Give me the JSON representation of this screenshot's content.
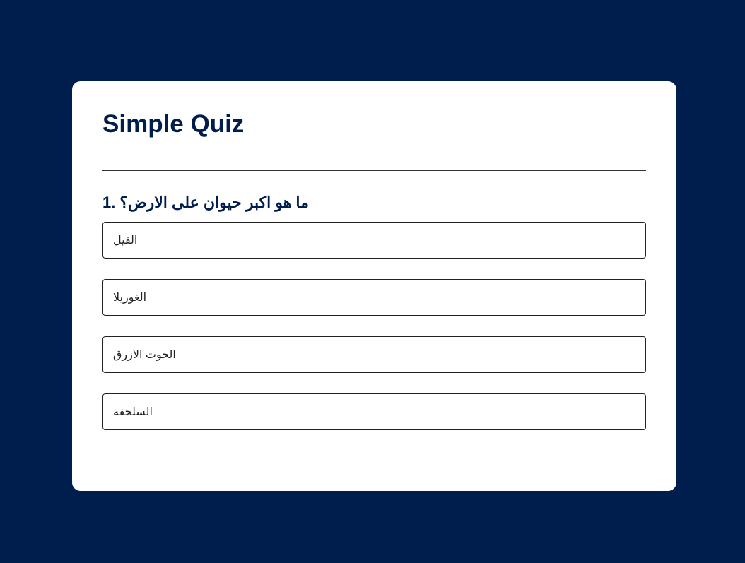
{
  "quiz": {
    "title": "Simple Quiz",
    "question": {
      "number": "1.",
      "text": "ما هو اكبر حيوان على الارض؟"
    },
    "answers": [
      {
        "label": "الفيل"
      },
      {
        "label": "الغوريلا"
      },
      {
        "label": "الحوت الازرق"
      },
      {
        "label": "السلحفة"
      }
    ]
  },
  "colors": {
    "background": "#001e4d",
    "card": "#ffffff",
    "title_text": "#001e4d"
  }
}
